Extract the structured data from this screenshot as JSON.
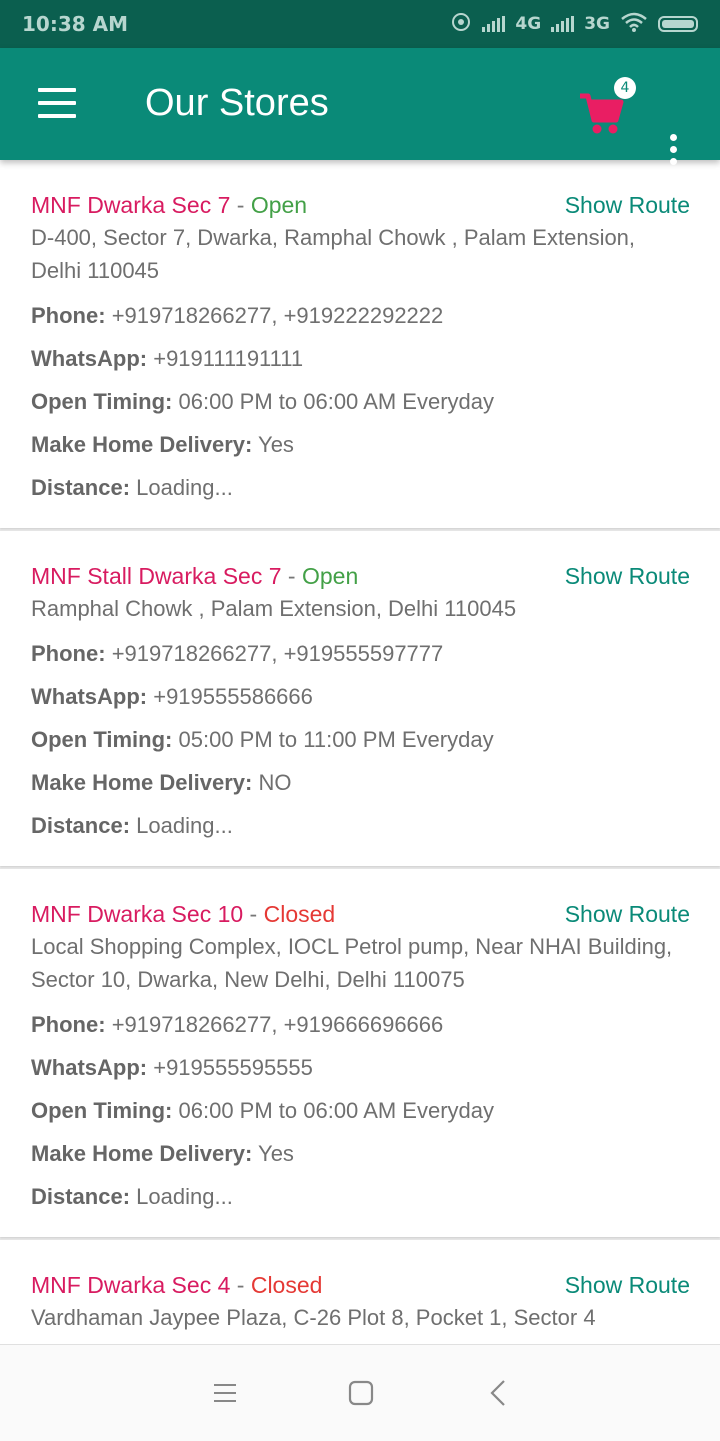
{
  "status_bar": {
    "time": "10:38 AM",
    "net1": "4G",
    "net2": "3G",
    "icons": [
      "hotspot-icon",
      "signal-icon",
      "signal-icon",
      "wifi-icon",
      "battery-icon"
    ]
  },
  "app_bar": {
    "title": "Our Stores",
    "cart_count": "4",
    "colors": {
      "primary": "#0a8a78",
      "accent": "#d81b60"
    }
  },
  "labels": {
    "show_route": "Show Route",
    "phone": "Phone:",
    "whatsapp": "WhatsApp:",
    "timing": "Open Timing:",
    "delivery": "Make Home Delivery:",
    "distance": "Distance:",
    "separator": " - "
  },
  "stores": [
    {
      "name": "MNF Dwarka Sec 7",
      "status": "Open",
      "address": "D-400, Sector 7, Dwarka, Ramphal Chowk , Palam Extension, Delhi 110045",
      "phone": "+919718266277,  +919222292222",
      "whatsapp": "+919111191111",
      "timing": "06:00 PM to 06:00 AM Everyday",
      "delivery": "Yes",
      "distance": "Loading..."
    },
    {
      "name": "MNF Stall Dwarka Sec 7",
      "status": "Open",
      "address": "Ramphal Chowk , Palam Extension, Delhi 110045",
      "phone": "+919718266277,  +919555597777",
      "whatsapp": "+919555586666",
      "timing": "05:00 PM to 11:00 PM Everyday",
      "delivery": "NO",
      "distance": "Loading..."
    },
    {
      "name": "MNF Dwarka Sec 10",
      "status": "Closed",
      "address": "Local Shopping Complex, IOCL Petrol pump, Near NHAI Building, Sector 10, Dwarka, New Delhi, Delhi 110075",
      "phone": "+919718266277,  +919666696666",
      "whatsapp": "+919555595555",
      "timing": "06:00 PM to 06:00 AM Everyday",
      "delivery": "Yes",
      "distance": "Loading..."
    },
    {
      "name": "MNF Dwarka Sec 4",
      "status": "Closed",
      "address": "Vardhaman Jaypee Plaza, C-26 Plot 8, Pocket 1, Sector 4"
    }
  ]
}
